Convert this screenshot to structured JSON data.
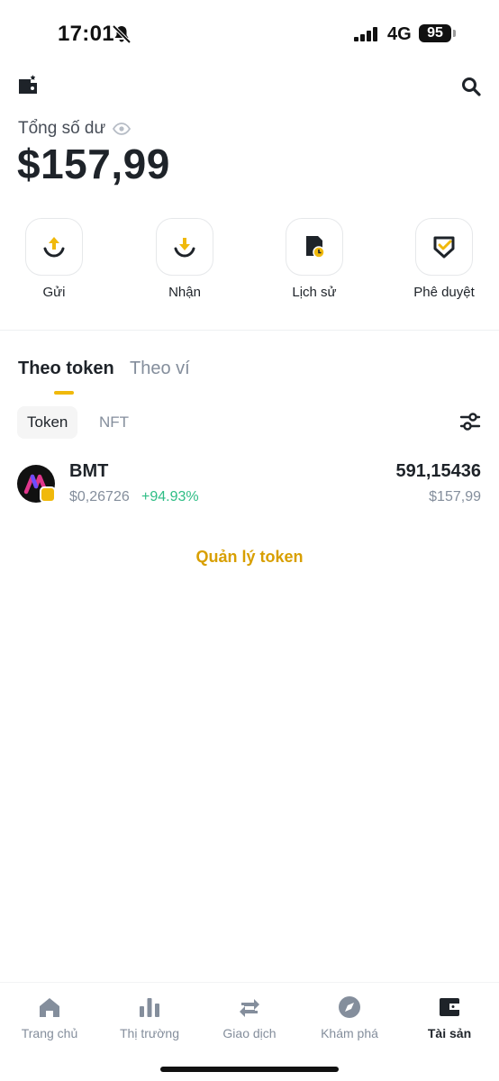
{
  "status_bar": {
    "time": "17:01",
    "network": "4G",
    "battery": "95"
  },
  "balance": {
    "label": "Tổng số dư",
    "value": "$157,99"
  },
  "actions": [
    {
      "label": "Gửi",
      "icon": "send-icon"
    },
    {
      "label": "Nhận",
      "icon": "receive-icon"
    },
    {
      "label": "Lịch sử",
      "icon": "history-icon"
    },
    {
      "label": "Phê duyệt",
      "icon": "approval-icon"
    }
  ],
  "tabs": {
    "active": "Theo token",
    "inactive": "Theo ví"
  },
  "chips": {
    "token": "Token",
    "nft": "NFT"
  },
  "token": {
    "symbol": "BMT",
    "price": "$0,26726",
    "change": "+94.93%",
    "amount": "591,15436",
    "value": "$157,99"
  },
  "manage_token": "Quản lý token",
  "bottom_nav": [
    {
      "label": "Trang chủ",
      "icon": "home-icon"
    },
    {
      "label": "Thị trường",
      "icon": "market-icon"
    },
    {
      "label": "Giao dịch",
      "icon": "trade-icon"
    },
    {
      "label": "Khám phá",
      "icon": "discover-icon"
    },
    {
      "label": "Tài sản",
      "icon": "wallet-icon",
      "active": true
    }
  ],
  "colors": {
    "accent": "#f0b90b",
    "positive": "#2ebd85",
    "text_primary": "#1e2329",
    "text_secondary": "#848e9c"
  }
}
